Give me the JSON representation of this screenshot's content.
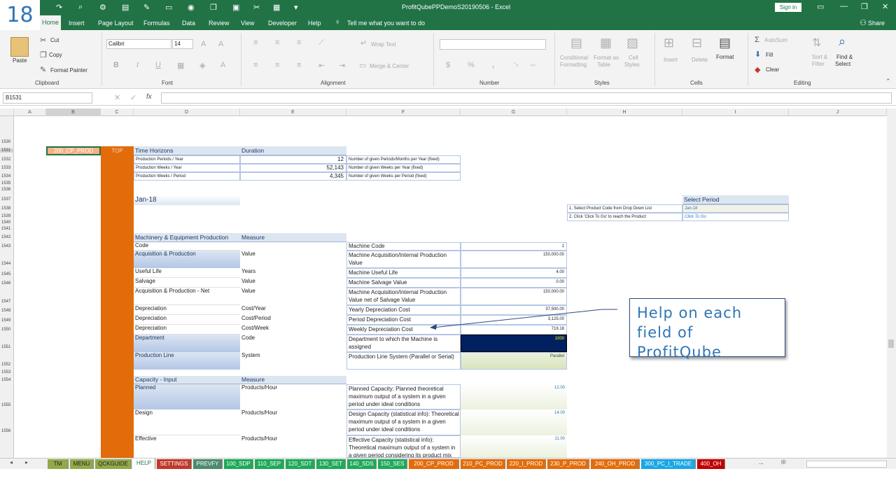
{
  "slide_number": "18",
  "window": {
    "title": "ProfitQubePPDemoS20190506  -  Excel",
    "signin": "Sign in",
    "share": "Share",
    "tell_me": "Tell me what you want to do"
  },
  "tabs": [
    "Home",
    "Insert",
    "Page Layout",
    "Formulas",
    "Data",
    "Review",
    "View",
    "Developer",
    "Help"
  ],
  "ribbon": {
    "clipboard": {
      "label": "Clipboard",
      "paste": "Paste",
      "cut": "Cut",
      "copy": "Copy",
      "format_painter": "Format Painter"
    },
    "font": {
      "label": "Font",
      "family": "Calibri",
      "size": "14"
    },
    "alignment": {
      "label": "Alignment",
      "wrap": "Wrap Text",
      "merge": "Merge & Center"
    },
    "number": {
      "label": "Number",
      "format": ""
    },
    "styles": {
      "label": "Styles",
      "cond1": "Conditional",
      "cond2": "Formatting",
      "fmt1": "Format as",
      "fmt2": "Table",
      "cell1": "Cell",
      "cell2": "Styles"
    },
    "cells": {
      "label": "Cells",
      "insert": "Insert",
      "delete": "Delete",
      "format": "Format"
    },
    "editing": {
      "label": "Editing",
      "autosum": "AutoSum",
      "fill": "Fill",
      "clear": "Clear",
      "sort1": "Sort &",
      "sort2": "Filter",
      "find1": "Find &",
      "find2": "Select"
    }
  },
  "formula_bar": {
    "name_box": "B1531",
    "formula": ""
  },
  "columns": [
    "A",
    "B",
    "C",
    "D",
    "E",
    "F",
    "G",
    "H",
    "I",
    "J"
  ],
  "rows": {
    "r1530": "1530",
    "r1531": "1531",
    "r1532": "1532",
    "r1533": "1533",
    "r1534": "1534",
    "r1535": "1535",
    "r1536": "1536",
    "r1537": "1537",
    "r1538": "1538",
    "r1539": "1539",
    "r1540": "1540",
    "r1541": "1541",
    "r1542": "1542",
    "r1543": "1543",
    "r1544": "1544",
    "r1545": "1545",
    "r1546": "1546",
    "r1547": "1547",
    "r1548": "1548",
    "r1549": "1549",
    "r1550": "1550",
    "r1551": "1551",
    "r1552": "1552",
    "r1553": "1553",
    "r1554": "1554",
    "r1555": "1555",
    "r1556": "1556"
  },
  "sheet": {
    "b1531": "200_CP_PROD",
    "c1531": "TOP",
    "time_hdr": "Time Horizons",
    "dur_hdr": "Duration",
    "tp1": "Production Periods / Year",
    "tv1": "12",
    "tn1": "Number of given Periods/Months per Year (fixed)",
    "tp2": "Production Weeks / Year",
    "tv2": "52,143",
    "tn2": "Number of given Weeks per Year (fixed)",
    "tp3": "Production Weeks / Period",
    "tv3": "4,345",
    "tn3": "Number of given Weeks per Period (fixed)",
    "period": "Jan-18",
    "sel_hdr": "Select Period",
    "sel1": "1. Select Product Code from Drop Down List",
    "sel1v": "Jan-18",
    "sel2": "2. Click 'Click To Go' to reach the Product",
    "sel2v": "Click To Go",
    "mach_hdr": "Machinery & Equipment Production",
    "meas_hdr": "Measure",
    "m": [
      [
        "Code",
        "",
        "Machine Code",
        "1"
      ],
      [
        "Acquisition & Production",
        "Value",
        "Machine Acquisition/Internal Production Value",
        "150,000.00"
      ],
      [
        "Useful Life",
        "Years",
        "Machine Useful Life",
        "4.00"
      ],
      [
        "Salvage",
        "Value",
        "Machine Salvage Value",
        "0.00"
      ],
      [
        "Acquisition & Production - Net",
        "Value",
        "Machine Acquisition/Internal Production Value net of Salvage Value",
        "150,000.00"
      ],
      [
        "Depreciation",
        "Cost/Year",
        "Yearly Depreciation Cost",
        "37,500.00"
      ],
      [
        "Depreciation",
        "Cost/Period",
        "Period Depreciation Cost",
        "3,125.00"
      ],
      [
        "Depreciation",
        "Cost/Week",
        "Weekly Depreciation Cost",
        "719.18"
      ],
      [
        "Department",
        "Code",
        "Department to which the Machine is assigned",
        "1000"
      ],
      [
        "Production Line",
        "System",
        "Production Line System (Parallel or Serial)",
        "Parallel"
      ]
    ],
    "cap_hdr": "Capacity - Input",
    "cap_meas": "Measure",
    "c": [
      [
        "Planned",
        "Products/Hour",
        "Planned Capacity: Planned theoretical maximum output of a system in a given period under ideal conditions",
        "12.00"
      ],
      [
        "Design",
        "Products/Hour",
        "Design Capacity (statistical info): Theoretical maximum output of a system in a given period under ideal conditions",
        "14.00"
      ],
      [
        "Effective",
        "Products/Hour",
        "Effective Capacity (statistical info): Theoretical maximum output of a system in a given period considering its product mix",
        "11.00"
      ]
    ]
  },
  "callout": "Help on each field of ProfitQube",
  "sheet_tabs": [
    {
      "label": "TM",
      "color": "#92a94a"
    },
    {
      "label": "MENU",
      "color": "#92a94a"
    },
    {
      "label": "QCKGUIDE",
      "color": "#92a94a"
    },
    {
      "label": "HELP",
      "color": "#ffffff"
    },
    {
      "label": "SETTINGS",
      "color": "#c0392b"
    },
    {
      "label": "PREVFY",
      "color": "#4e8a6f"
    },
    {
      "label": "100_SDP",
      "color": "#1faa5a"
    },
    {
      "label": "110_SEP",
      "color": "#1faa5a"
    },
    {
      "label": "120_SDT",
      "color": "#1faa5a"
    },
    {
      "label": "130_SET",
      "color": "#1faa5a"
    },
    {
      "label": "140_SDS",
      "color": "#1faa5a"
    },
    {
      "label": "150_SES",
      "color": "#1faa5a"
    },
    {
      "label": "200_CP_PROD",
      "color": "#e36c0a"
    },
    {
      "label": "210_PC_PROD",
      "color": "#e36c0a"
    },
    {
      "label": "220_I_PROD",
      "color": "#e36c0a"
    },
    {
      "label": "230_P_PROD",
      "color": "#e36c0a"
    },
    {
      "label": "240_OH_PROD",
      "color": "#e36c0a"
    },
    {
      "label": "300_PC_I_TRADE",
      "color": "#1aa7e6"
    },
    {
      "label": "400_OH",
      "color": "#c00000"
    }
  ],
  "sheet_more": "..."
}
